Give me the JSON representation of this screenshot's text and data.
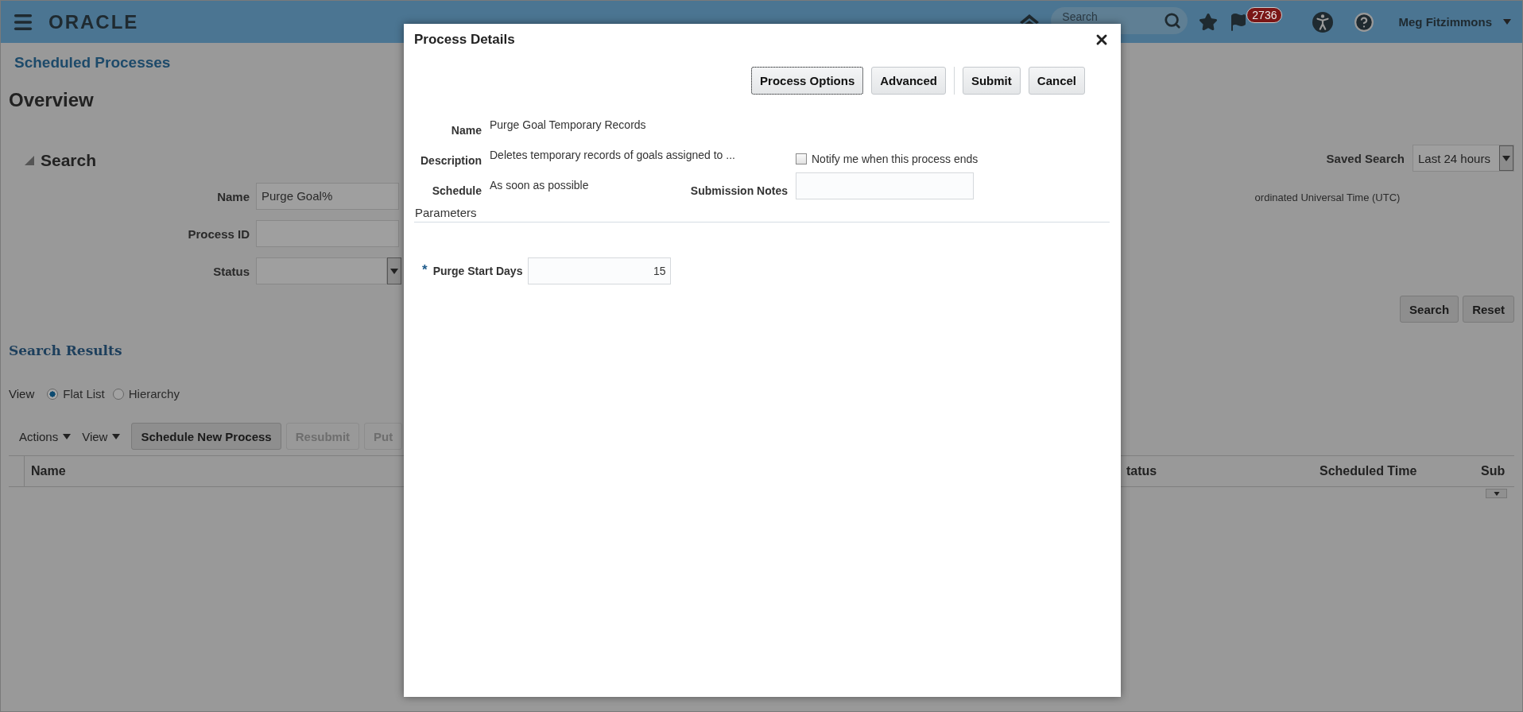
{
  "header": {
    "logo": "ORACLE",
    "search": {
      "placeholder": "Search"
    },
    "notifications": {
      "count": "2736"
    },
    "user": "Meg Fitzimmons"
  },
  "page": {
    "breadcrumb": "Scheduled Processes",
    "title": "Overview"
  },
  "search_panel": {
    "title": "Search",
    "expanded": true,
    "fields": [
      {
        "label": "Name",
        "kind": "text",
        "value": "Purge Goal%"
      },
      {
        "label": "Process ID",
        "kind": "text"
      },
      {
        "label": "Status",
        "kind": "select"
      }
    ],
    "saved_search": {
      "label": "Saved Search",
      "value": "Last 24 hours"
    },
    "time_zone_note": "ordinated Universal Time (UTC)",
    "buttons": [
      "Search",
      "Reset"
    ]
  },
  "results": {
    "title": "Search Results",
    "view_label": "View",
    "view_options": [
      {
        "label": "Flat List",
        "selected": true
      },
      {
        "label": "Hierarchy",
        "selected": false
      }
    ],
    "menus": [
      "Actions",
      "View"
    ],
    "toolbar_buttons": [
      {
        "label": "Schedule New Process",
        "disabled": false
      },
      {
        "label": "Resubmit",
        "disabled": true
      },
      {
        "label": "Put",
        "disabled": true
      }
    ],
    "columns": [
      {
        "label": "Name"
      },
      {
        "label": "tatus"
      },
      {
        "label": "Scheduled Time"
      },
      {
        "label": "Sub"
      }
    ]
  },
  "dialog": {
    "title": "Process Details",
    "buttons": [
      {
        "label": "Process Options",
        "focused": true
      },
      {
        "label": "Advanced",
        "focused": false
      },
      {
        "label": "Submit",
        "focused": false
      },
      {
        "label": "Cancel",
        "focused": false
      }
    ],
    "fields": [
      {
        "label": "Name",
        "value": "Purge Goal Temporary Records"
      },
      {
        "label": "Description",
        "value": "Deletes temporary records of goals assigned to ..."
      },
      {
        "label": "Schedule",
        "value": "As soon as possible"
      }
    ],
    "notify": {
      "label": "Notify me when this process ends",
      "checked": false
    },
    "submission_notes": {
      "label": "Submission Notes"
    },
    "parameters": {
      "title": "Parameters",
      "fields": [
        {
          "label": "Purge Start Days",
          "required": true,
          "required_mark": "*",
          "value": "15"
        }
      ]
    }
  }
}
